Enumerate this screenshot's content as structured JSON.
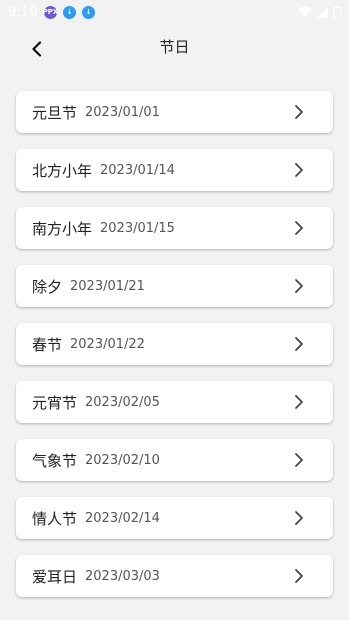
{
  "status_bar": {
    "time": "9:10",
    "notifications": [
      {
        "icon": "ppx-app-icon",
        "glyph": "PPX",
        "color": "#6e5ad1"
      },
      {
        "icon": "download-icon",
        "glyph": "↓",
        "color": "#2f9bf2"
      },
      {
        "icon": "download-icon",
        "glyph": "↓",
        "color": "#2f9bf2"
      }
    ],
    "right_icons": [
      "wifi-icon",
      "signal-icon",
      "battery-icon"
    ]
  },
  "header": {
    "back_icon": "chevron-left-icon",
    "title": "节日"
  },
  "holidays": [
    {
      "name": "元旦节",
      "date": "2023/01/01"
    },
    {
      "name": "北方小年",
      "date": "2023/01/14"
    },
    {
      "name": "南方小年",
      "date": "2023/01/15"
    },
    {
      "name": "除夕",
      "date": "2023/01/21"
    },
    {
      "name": "春节",
      "date": "2023/01/22"
    },
    {
      "name": "元宵节",
      "date": "2023/02/05"
    },
    {
      "name": "气象节",
      "date": "2023/02/10"
    },
    {
      "name": "情人节",
      "date": "2023/02/14"
    },
    {
      "name": "爱耳日",
      "date": "2023/03/03"
    }
  ]
}
